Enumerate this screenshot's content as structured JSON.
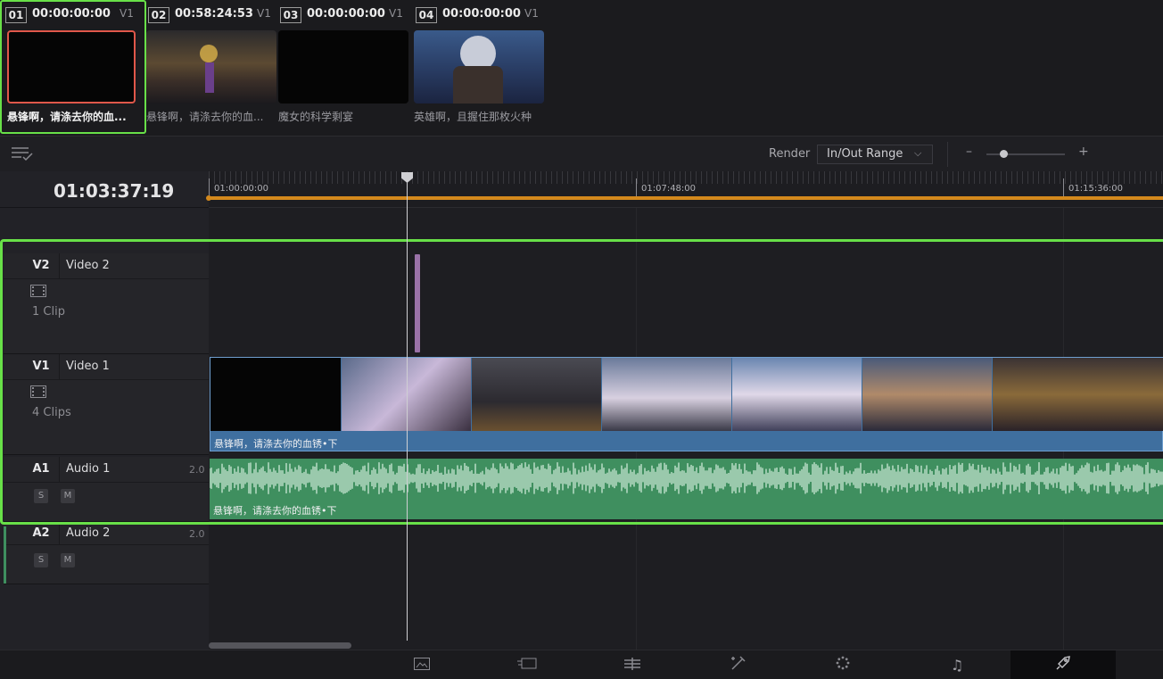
{
  "clips": [
    {
      "num": "01",
      "timecode": "00:00:00:00",
      "track": "V1",
      "name": "悬锋啊，请涤去你的血..."
    },
    {
      "num": "02",
      "timecode": "00:58:24:53",
      "track": "V1",
      "name": "悬锋啊，请涤去你的血..."
    },
    {
      "num": "03",
      "timecode": "00:00:00:00",
      "track": "V1",
      "name": "魔女的科学剩宴"
    },
    {
      "num": "04",
      "timecode": "00:00:00:00",
      "track": "V1",
      "name": "英雄啊，且握住那枚火种"
    }
  ],
  "toolbar": {
    "render_label": "Render",
    "render_value": "In/Out Range",
    "zoom_minus": "–",
    "zoom_plus": "+"
  },
  "timeline": {
    "current_timecode": "01:03:37:19",
    "ruler_marks": [
      "01:00:00:00",
      "01:07:48:00",
      "01:15:36:00"
    ]
  },
  "tracks": {
    "v2": {
      "id": "V2",
      "name": "Video 2",
      "count": "1 Clip"
    },
    "v1": {
      "id": "V1",
      "name": "Video 1",
      "count": "4 Clips",
      "clip_label": "悬锋啊，请涤去你的血锈•下"
    },
    "a1": {
      "id": "A1",
      "name": "Audio 1",
      "channels": "2.0",
      "solo": "S",
      "mute": "M",
      "clip_label": "悬锋啊，请涤去你的血锈•下"
    },
    "a2": {
      "id": "A2",
      "name": "Audio 2",
      "channels": "2.0",
      "solo": "S",
      "mute": "M"
    }
  },
  "page_tabs": [
    "media-icon",
    "cut-icon",
    "edit-icon",
    "fusion-icon",
    "color-icon",
    "fairlight-icon",
    "deliver-icon"
  ],
  "colors": {
    "highlight": "#68e048",
    "video_clip": "#3f6f9f",
    "audio_clip": "#3f8f5f",
    "ruler_bar": "#d4891c",
    "v2_clip": "#9a72a8"
  }
}
